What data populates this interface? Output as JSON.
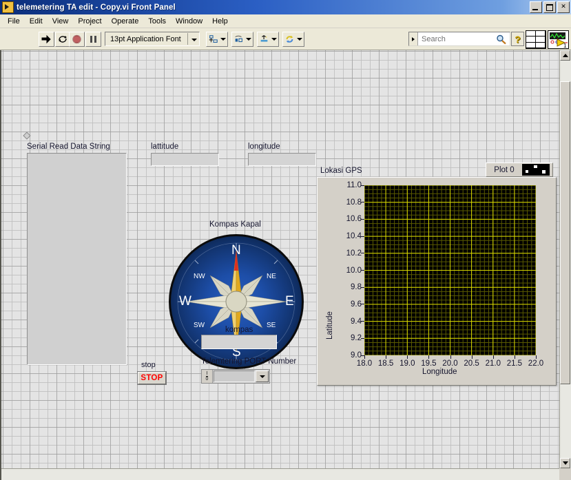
{
  "window": {
    "title": "telemetering TA edit - Copy.vi Front Panel",
    "icon": "labview-vi-icon",
    "minimize": "minimize-button",
    "maximize": "maximize-button",
    "close_label": "✕"
  },
  "menu": {
    "items": [
      "File",
      "Edit",
      "View",
      "Project",
      "Operate",
      "Tools",
      "Window",
      "Help"
    ]
  },
  "toolbar": {
    "run": "run-arrow-icon",
    "run_continuously": "run-continuously-icon",
    "abort": "abort-execution-icon",
    "pause": "pause-icon",
    "font_selector": "13pt Application Font",
    "align_objects": "align-objects-icon",
    "distribute_objects": "distribute-objects-icon",
    "resize_objects": "resize-objects-icon",
    "reorder": "reorder-icon",
    "search_placeholder": "Search",
    "search_icon": "magnifier-icon",
    "help_label": "?",
    "connector_pane": "connector-pane",
    "vi_icon_number": "1"
  },
  "panel": {
    "serial_string": {
      "label": "Serial Read Data String",
      "value": ""
    },
    "lattitude": {
      "label": "lattitude",
      "value": ""
    },
    "longitude": {
      "label": "longitude",
      "value": ""
    },
    "compass": {
      "label": "Kompas Kapal",
      "cardinals": [
        "N",
        "E",
        "S",
        "W"
      ],
      "ordinals": [
        "NW",
        "NE",
        "SE",
        "SW"
      ],
      "needle_heading_deg": 0,
      "dial_color": "#1d4ea8",
      "needle_color": "#e8b820",
      "needle_tip_color": "#e03020"
    },
    "kompas_indicator": {
      "label": "kompas",
      "value": ""
    },
    "stop_button": {
      "label": "stop",
      "button_text": "STOP",
      "text_color": "#ff0000"
    },
    "port_selector": {
      "label": "Telemtering PORT Number",
      "value": "",
      "glyph": "I/O",
      "dropdown_icon": "chevron-down-icon"
    },
    "graph": {
      "label": "Lokasi GPS"
    }
  },
  "chart_data": {
    "type": "scatter",
    "title": "Lokasi GPS",
    "xlabel": "Longitude",
    "ylabel": "Latitude",
    "xlim": [
      18.0,
      22.0
    ],
    "ylim": [
      9.0,
      11.0
    ],
    "xticks": [
      "18.0",
      "18.5",
      "19.0",
      "19.5",
      "20.0",
      "20.5",
      "21.0",
      "21.5",
      "22.0"
    ],
    "yticks": [
      "9.0",
      "9.2",
      "9.4",
      "9.6",
      "9.8",
      "10.0",
      "10.2",
      "10.4",
      "10.6",
      "10.8",
      "11.0"
    ],
    "xtick_values": [
      18.0,
      18.5,
      19.0,
      19.5,
      20.0,
      20.5,
      21.0,
      21.5,
      22.0
    ],
    "ytick_values": [
      9.0,
      9.2,
      9.4,
      9.6,
      9.8,
      10.0,
      10.2,
      10.4,
      10.6,
      10.8,
      11.0
    ],
    "grid": true,
    "grid_color": "#d8d800",
    "minor_grid_color": "#5a5a00",
    "background": "#000000",
    "legend_position": "top-right",
    "series": [
      {
        "name": "Plot 0",
        "marker": "point",
        "color": "#ffffff",
        "x": [],
        "y": []
      }
    ]
  },
  "scrollbars": {
    "vertical_up": "scroll-up-arrow",
    "vertical_down": "scroll-down-arrow",
    "horizontal": "horizontal-scrollbar"
  }
}
